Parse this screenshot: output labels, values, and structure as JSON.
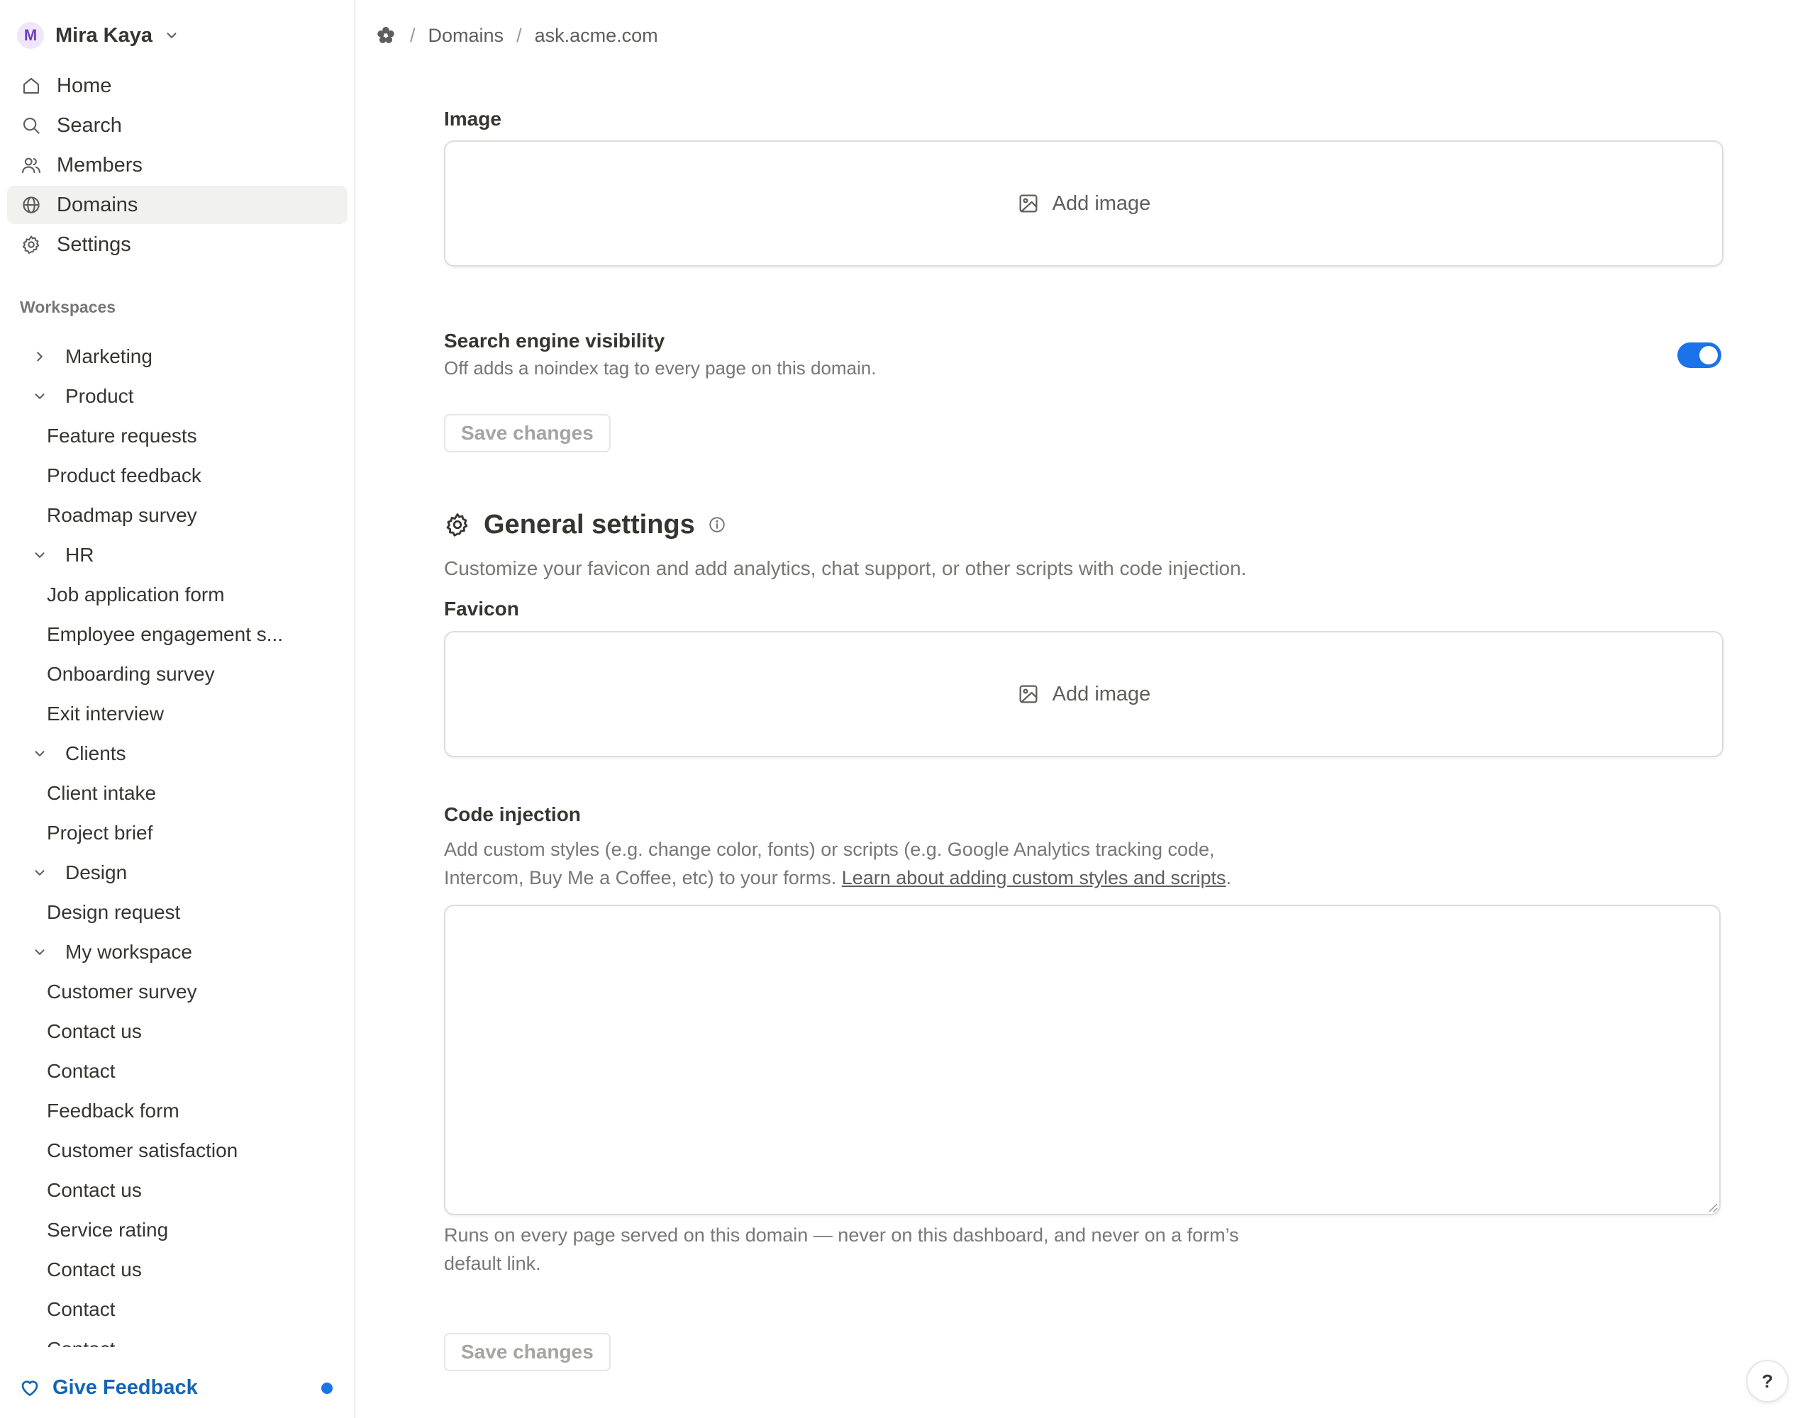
{
  "user": {
    "initial": "M",
    "name": "Mira Kaya"
  },
  "nav": {
    "home": "Home",
    "search": "Search",
    "members": "Members",
    "domains": "Domains",
    "settings": "Settings"
  },
  "workspaces_label": "Workspaces",
  "tree": [
    {
      "kind": "ws",
      "label": "Marketing",
      "expanded": false
    },
    {
      "kind": "ws",
      "label": "Product",
      "expanded": true
    },
    {
      "kind": "form",
      "label": "Feature requests"
    },
    {
      "kind": "form",
      "label": "Product feedback"
    },
    {
      "kind": "form",
      "label": "Roadmap survey"
    },
    {
      "kind": "ws",
      "label": "HR",
      "expanded": true
    },
    {
      "kind": "form",
      "label": "Job application form"
    },
    {
      "kind": "form",
      "label": "Employee engagement s..."
    },
    {
      "kind": "form",
      "label": "Onboarding survey"
    },
    {
      "kind": "form",
      "label": "Exit interview"
    },
    {
      "kind": "ws",
      "label": "Clients",
      "expanded": true
    },
    {
      "kind": "form",
      "label": "Client intake"
    },
    {
      "kind": "form",
      "label": "Project brief"
    },
    {
      "kind": "ws",
      "label": "Design",
      "expanded": true
    },
    {
      "kind": "form",
      "label": "Design request"
    },
    {
      "kind": "ws",
      "label": "My workspace",
      "expanded": true
    },
    {
      "kind": "form",
      "label": "Customer survey"
    },
    {
      "kind": "form",
      "label": "Contact us"
    },
    {
      "kind": "form",
      "label": "Contact"
    },
    {
      "kind": "form",
      "label": "Feedback form"
    },
    {
      "kind": "form",
      "label": "Customer satisfaction"
    },
    {
      "kind": "form",
      "label": "Contact us"
    },
    {
      "kind": "form",
      "label": "Service rating"
    },
    {
      "kind": "form",
      "label": "Contact us"
    },
    {
      "kind": "form",
      "label": "Contact"
    },
    {
      "kind": "form",
      "label": "Contact"
    }
  ],
  "feedback": {
    "label": "Give Feedback"
  },
  "breadcrumb": {
    "domains": "Domains",
    "domain": "ask.acme.com"
  },
  "image_section": {
    "label": "Image",
    "add_label": "Add image"
  },
  "visibility": {
    "title": "Search engine visibility",
    "description": "Off adds a noindex tag to every page on this domain.",
    "enabled": true
  },
  "save_label": "Save changes",
  "general": {
    "title": "General settings",
    "description": "Customize your favicon and add analytics, chat support, or other scripts with code injection."
  },
  "favicon": {
    "label": "Favicon",
    "add_label": "Add image"
  },
  "code_injection": {
    "label": "Code injection",
    "description_line1": "Add custom styles (e.g. change color, fonts) or scripts (e.g. Google Analytics tracking code,",
    "description_line2": "Intercom, Buy Me a Coffee, etc) to your forms. ",
    "link": "Learn about adding custom styles and scripts",
    "after_link": ".",
    "value": "",
    "note_line1": "Runs on every page served on this domain — never on this dashboard, and never on a form’s",
    "note_line2": "default link."
  },
  "help_label": "?",
  "colors": {
    "accent": "#1a73e8",
    "link": "#1464b4",
    "avatar_bg": "#efe6fb",
    "avatar_fg": "#6b3fc1"
  }
}
